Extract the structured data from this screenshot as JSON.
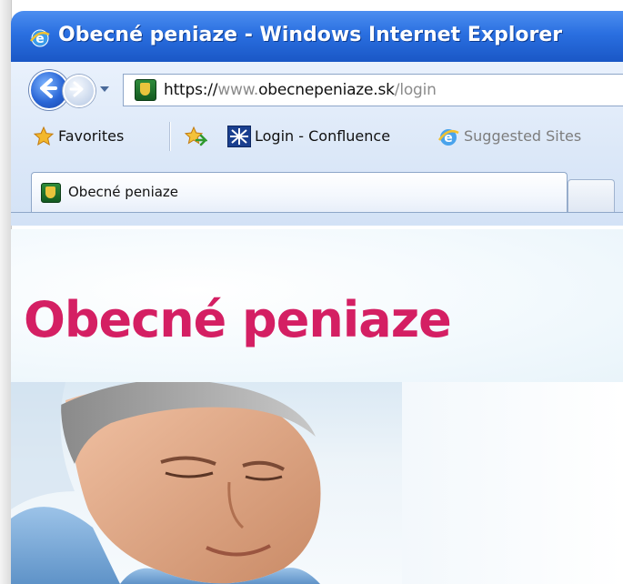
{
  "window": {
    "title": "Obecné peniaze - Windows Internet Explorer"
  },
  "address_bar": {
    "url_scheme": "https://",
    "url_prefix": "www.",
    "url_host": "obecnepeniaze.sk",
    "url_path": "/login"
  },
  "favorites_bar": {
    "favorites_label": "Favorites",
    "link_confluence": "Login - Confluence",
    "link_suggested": "Suggested Sites"
  },
  "tabs": [
    {
      "label": "Obecné peniaze"
    }
  ],
  "page": {
    "logo_text": "Obecné peniaze"
  },
  "colors": {
    "titlebar": "#2a6fe0",
    "logo": "#d41f63",
    "chrome": "#dce8f8"
  },
  "icons": [
    "ie-logo-icon",
    "back-icon",
    "forward-icon",
    "chevron-down-icon",
    "site-favicon-icon",
    "favorites-star-icon",
    "add-favorites-icon",
    "confluence-icon",
    "suggested-sites-icon"
  ]
}
